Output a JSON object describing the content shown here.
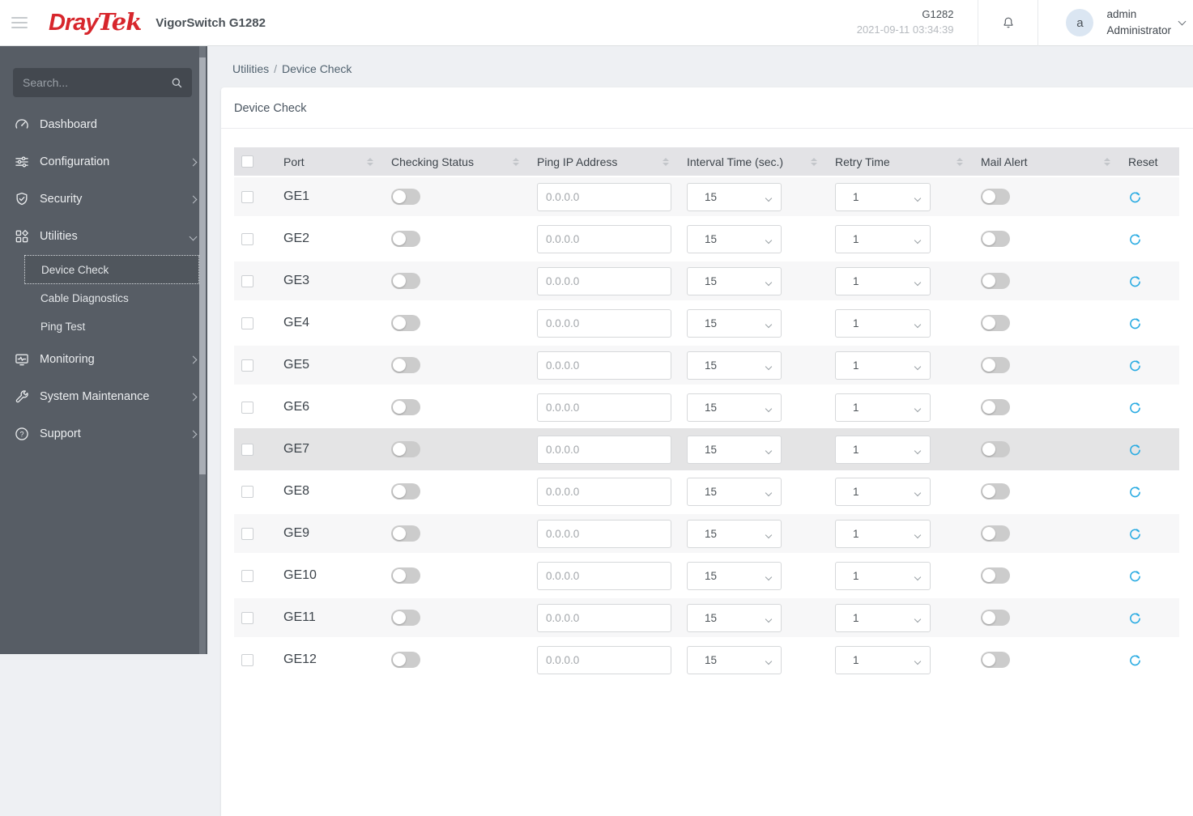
{
  "colors": {
    "brand_red": "#d7262c",
    "reset_icon_blue": "#29abe2",
    "sidebar_bg": "#575d65"
  },
  "topbar": {
    "brand": {
      "part1": "Dray",
      "part2": "Tek"
    },
    "product_name": "VigorSwitch G1282",
    "device_name": "G1282",
    "datetime": "2021-09-11 03:34:39",
    "user": {
      "avatar_letter": "a",
      "name": "admin",
      "role": "Administrator"
    }
  },
  "sidebar": {
    "search_placeholder": "Search...",
    "items": [
      {
        "label": "Dashboard"
      },
      {
        "label": "Configuration"
      },
      {
        "label": "Security"
      },
      {
        "label": "Utilities"
      },
      {
        "label": "Monitoring"
      },
      {
        "label": "System Maintenance"
      },
      {
        "label": "Support"
      }
    ],
    "utilities_submenu": [
      {
        "label": "Device Check"
      },
      {
        "label": "Cable Diagnostics"
      },
      {
        "label": "Ping Test"
      }
    ]
  },
  "breadcrumb": {
    "parent": "Utilities",
    "separator": "/",
    "current": "Device Check"
  },
  "page": {
    "title": "Device Check"
  },
  "table": {
    "columns": [
      "Port",
      "Checking Status",
      "Ping IP Address",
      "Interval Time (sec.)",
      "Retry Time",
      "Mail Alert",
      "Reset"
    ],
    "rows": [
      {
        "port": "GE1",
        "checking_status": false,
        "ping_ip": "0.0.0.0",
        "interval": "15",
        "retry": "1",
        "mail_alert": false
      },
      {
        "port": "GE2",
        "checking_status": false,
        "ping_ip": "0.0.0.0",
        "interval": "15",
        "retry": "1",
        "mail_alert": false
      },
      {
        "port": "GE3",
        "checking_status": false,
        "ping_ip": "0.0.0.0",
        "interval": "15",
        "retry": "1",
        "mail_alert": false
      },
      {
        "port": "GE4",
        "checking_status": false,
        "ping_ip": "0.0.0.0",
        "interval": "15",
        "retry": "1",
        "mail_alert": false
      },
      {
        "port": "GE5",
        "checking_status": false,
        "ping_ip": "0.0.0.0",
        "interval": "15",
        "retry": "1",
        "mail_alert": false
      },
      {
        "port": "GE6",
        "checking_status": false,
        "ping_ip": "0.0.0.0",
        "interval": "15",
        "retry": "1",
        "mail_alert": false
      },
      {
        "port": "GE7",
        "checking_status": false,
        "ping_ip": "0.0.0.0",
        "interval": "15",
        "retry": "1",
        "mail_alert": false,
        "highlighted": true
      },
      {
        "port": "GE8",
        "checking_status": false,
        "ping_ip": "0.0.0.0",
        "interval": "15",
        "retry": "1",
        "mail_alert": false
      },
      {
        "port": "GE9",
        "checking_status": false,
        "ping_ip": "0.0.0.0",
        "interval": "15",
        "retry": "1",
        "mail_alert": false
      },
      {
        "port": "GE10",
        "checking_status": false,
        "ping_ip": "0.0.0.0",
        "interval": "15",
        "retry": "1",
        "mail_alert": false
      },
      {
        "port": "GE11",
        "checking_status": false,
        "ping_ip": "0.0.0.0",
        "interval": "15",
        "retry": "1",
        "mail_alert": false
      },
      {
        "port": "GE12",
        "checking_status": false,
        "ping_ip": "0.0.0.0",
        "interval": "15",
        "retry": "1",
        "mail_alert": false
      }
    ]
  }
}
